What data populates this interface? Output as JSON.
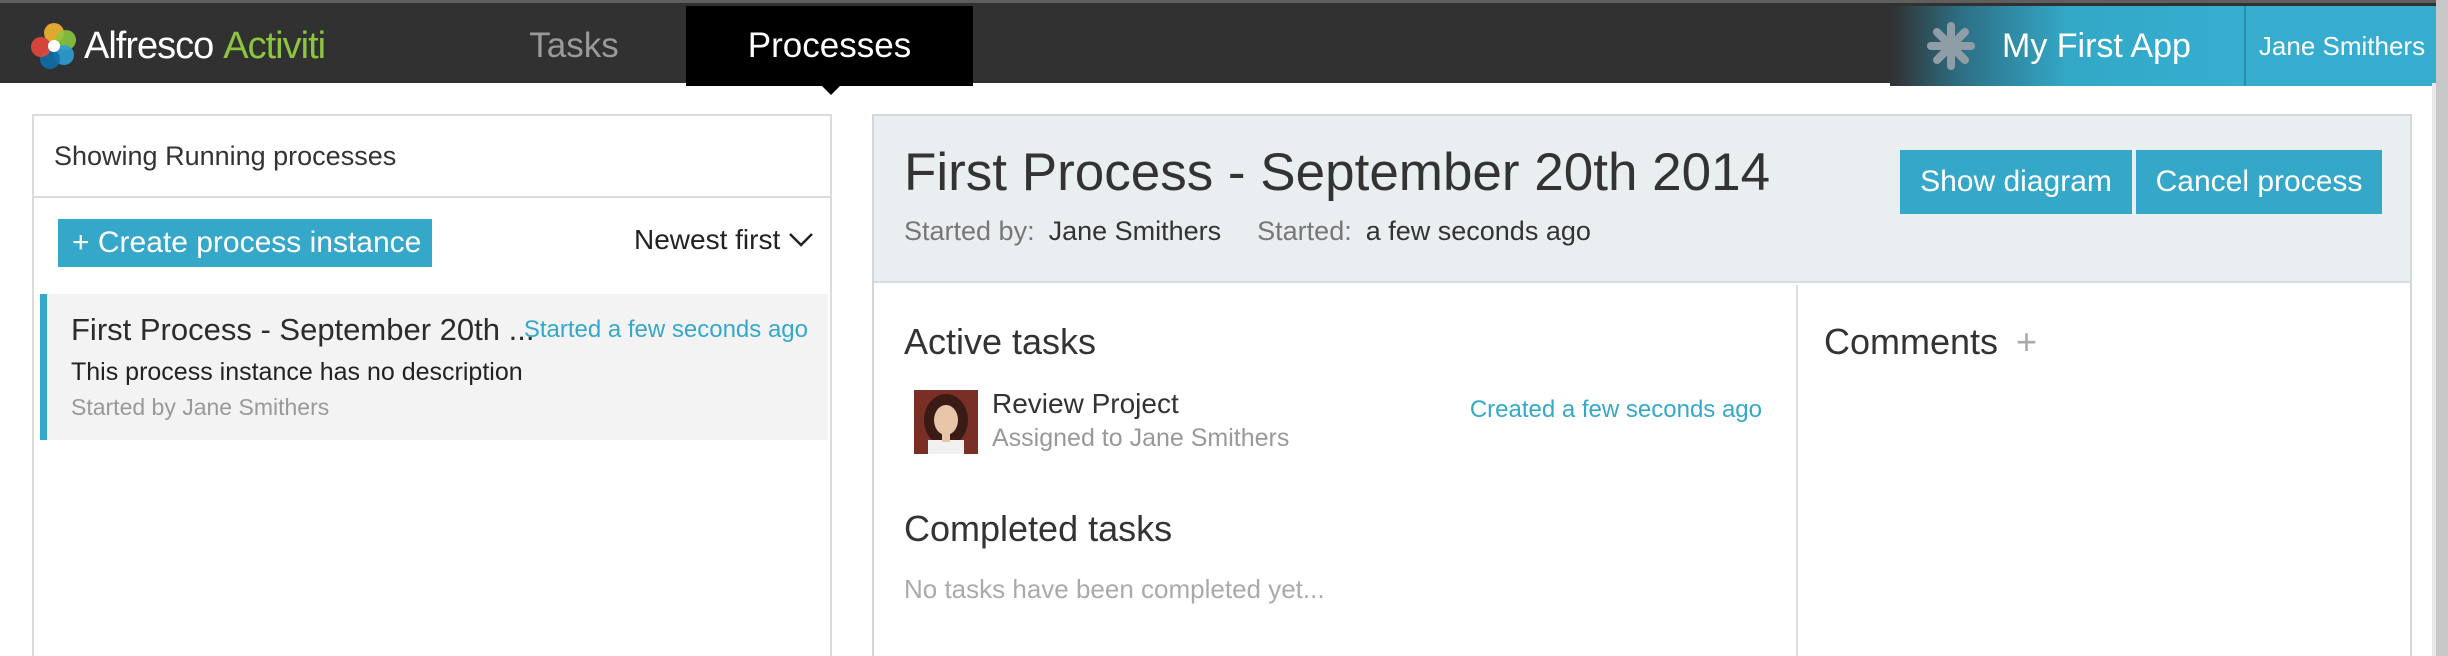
{
  "brand": {
    "name_main": "Alfresco",
    "name_accent": "Activiti",
    "accent_color": "#8cc63f"
  },
  "nav": {
    "tasks_label": "Tasks",
    "processes_label": "Processes"
  },
  "app": {
    "name": "My First App",
    "icon": "asterisk-app-icon"
  },
  "user": {
    "name": "Jane Smithers"
  },
  "process_list": {
    "header": "Showing Running processes",
    "create_label": "+ Create process instance",
    "sort_label": "Newest first",
    "items": [
      {
        "title": "First Process - September 20th ...",
        "started": "Started a few seconds ago",
        "description": "This process instance has no description",
        "started_by": "Started by Jane Smithers"
      }
    ]
  },
  "detail": {
    "title": "First Process - September 20th 2014",
    "started_by_label": "Started by:",
    "started_by_value": "Jane Smithers",
    "started_label": "Started:",
    "started_value": "a few seconds ago",
    "show_diagram_label": "Show diagram",
    "cancel_label": "Cancel process",
    "active_tasks_title": "Active tasks",
    "tasks": [
      {
        "name": "Review Project",
        "assigned": "Assigned to Jane Smithers",
        "created": "Created a few seconds ago"
      }
    ],
    "completed_tasks_title": "Completed tasks",
    "no_completed_text": "No tasks have been completed yet...",
    "comments_title": "Comments",
    "comments_add": "+"
  },
  "colors": {
    "accent": "#35a8c9",
    "topbar": "#313131",
    "active_tab": "#000000"
  }
}
